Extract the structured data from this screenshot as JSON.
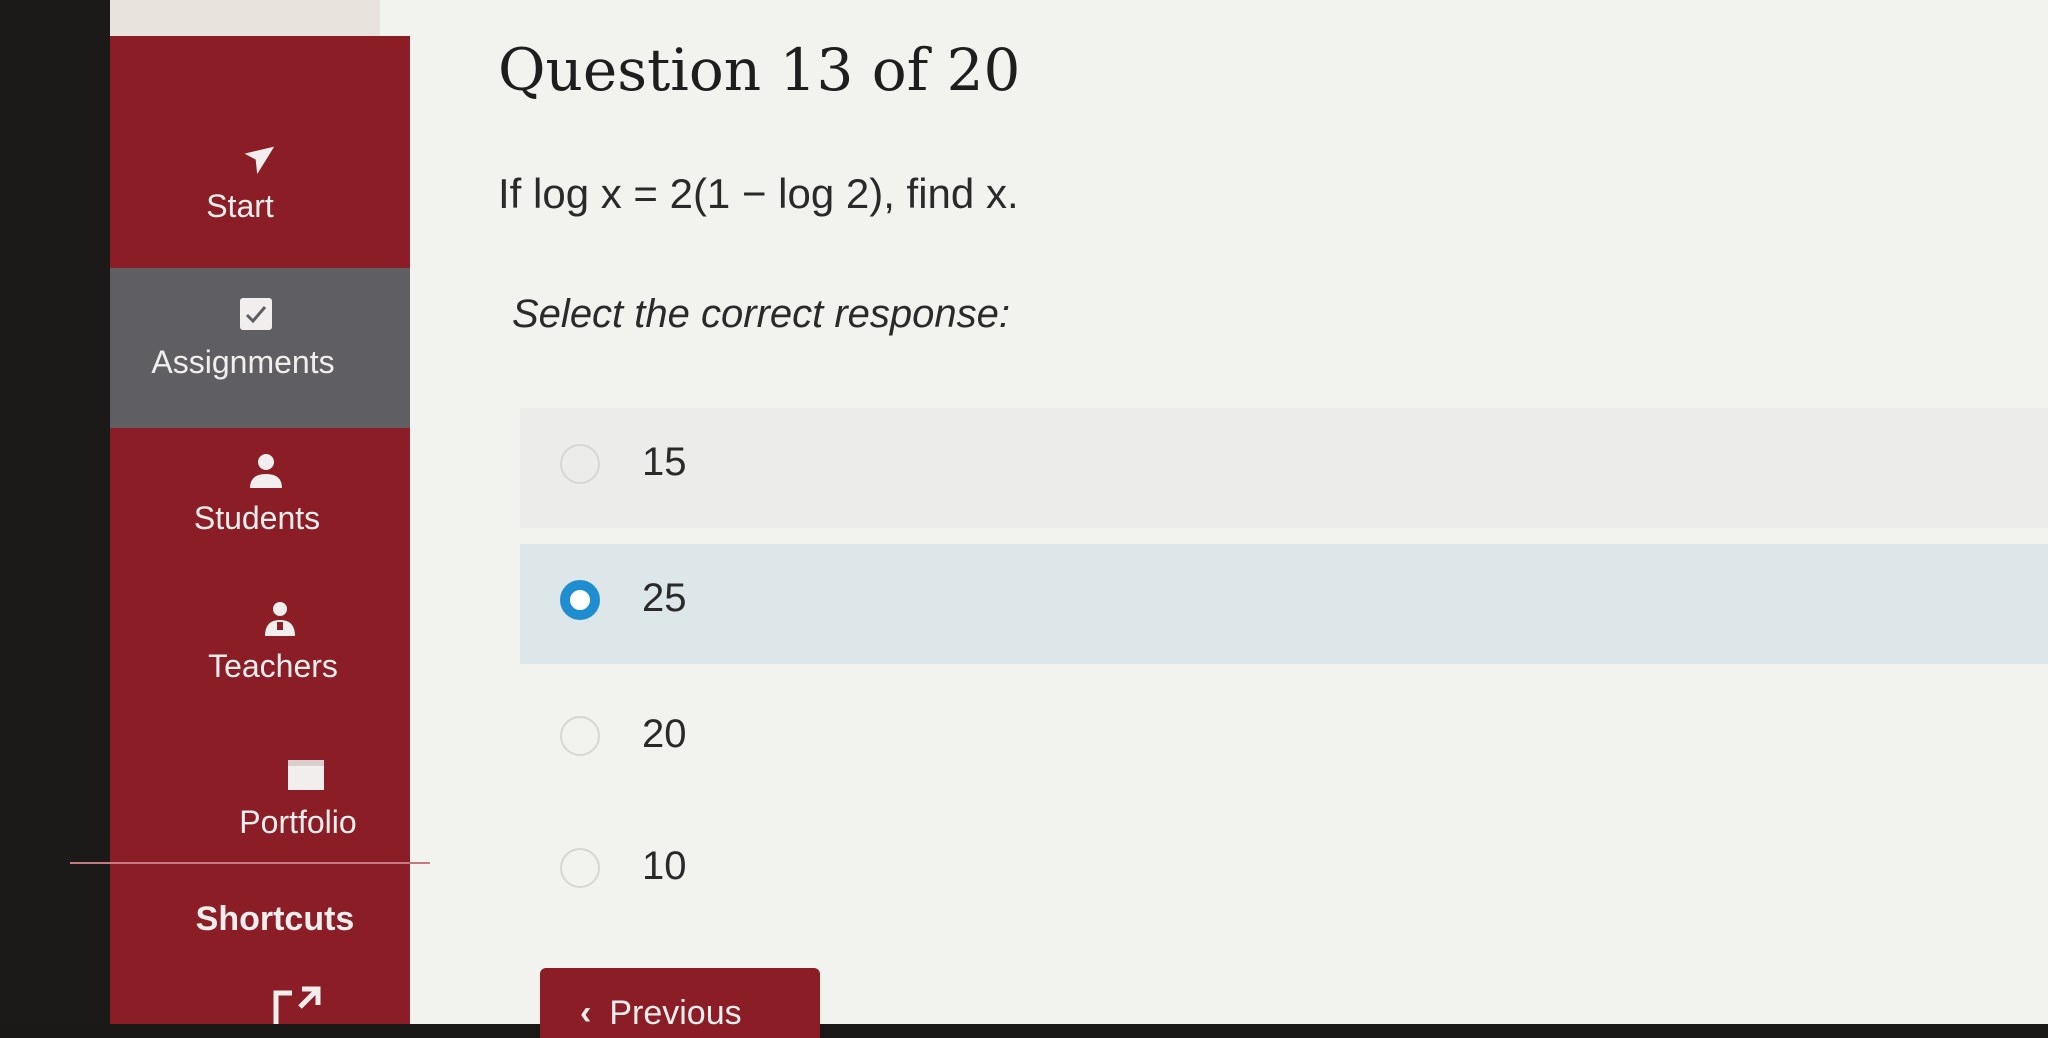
{
  "header": {
    "title": "Question 13 of 20"
  },
  "sidebar": {
    "items": [
      {
        "label": "Start",
        "icon": "navigation-arrow-icon"
      },
      {
        "label": "Assignments",
        "icon": "checklist-icon"
      },
      {
        "label": "Students",
        "icon": "student-icon"
      },
      {
        "label": "Teachers",
        "icon": "teacher-icon"
      },
      {
        "label": "Portfolio",
        "icon": "folder-icon"
      }
    ],
    "active_item": "Assignments",
    "shortcuts_label": "Shortcuts"
  },
  "question": {
    "text": "If log x = 2(1 − log 2), find x.",
    "prompt": "Select the correct response:"
  },
  "options": [
    {
      "label": "15",
      "selected": false
    },
    {
      "label": "25",
      "selected": true
    },
    {
      "label": "20",
      "selected": false
    },
    {
      "label": "10",
      "selected": false
    }
  ],
  "navigation": {
    "previous_label": "Previous"
  },
  "colors": {
    "sidebar": "#8b1d26",
    "active_item": "#5f5e63",
    "radio_selected": "#1f8ed1"
  }
}
